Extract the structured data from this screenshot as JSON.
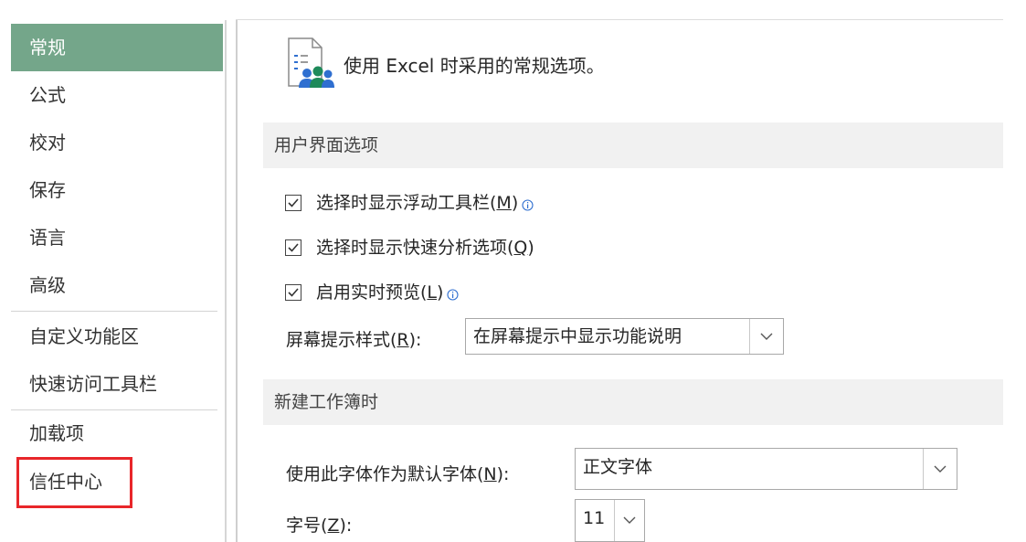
{
  "nav": {
    "items": [
      {
        "label": "常规",
        "selected": true
      },
      {
        "label": "公式"
      },
      {
        "label": "校对"
      },
      {
        "label": "保存"
      },
      {
        "label": "语言"
      },
      {
        "label": "高级"
      },
      {
        "label": "自定义功能区"
      },
      {
        "label": "快速访问工具栏"
      },
      {
        "label": "加载项"
      },
      {
        "label": "信任中心",
        "highlighted": true
      }
    ]
  },
  "header": {
    "text": "使用 Excel 时采用的常规选项。",
    "icon": "general-options-icon"
  },
  "sections": {
    "ui_options": {
      "title": "用户界面选项",
      "checkboxes": [
        {
          "label": "选择时显示浮动工具栏(",
          "key": "M",
          "suffix": ")",
          "checked": true,
          "info": true
        },
        {
          "label": "选择时显示快速分析选项(",
          "key": "Q",
          "suffix": ")",
          "checked": true,
          "info": false
        },
        {
          "label": "启用实时预览(",
          "key": "L",
          "suffix": ")",
          "checked": true,
          "info": true
        }
      ],
      "screentip": {
        "label": "屏幕提示样式(",
        "key": "R",
        "suffix": "):",
        "value": "在屏幕提示中显示功能说明"
      }
    },
    "new_workbook": {
      "title": "新建工作簿时",
      "font": {
        "label": "使用此字体作为默认字体(",
        "key": "N",
        "suffix": "):",
        "value": "正文字体"
      },
      "size": {
        "label": "字号(",
        "key": "Z",
        "suffix": "):",
        "value": "11"
      }
    }
  },
  "colors": {
    "selected_nav": "#74a68a",
    "highlight": "#e8262a",
    "section_bg": "#f1f1f1",
    "info_blue": "#2f6fd0"
  }
}
